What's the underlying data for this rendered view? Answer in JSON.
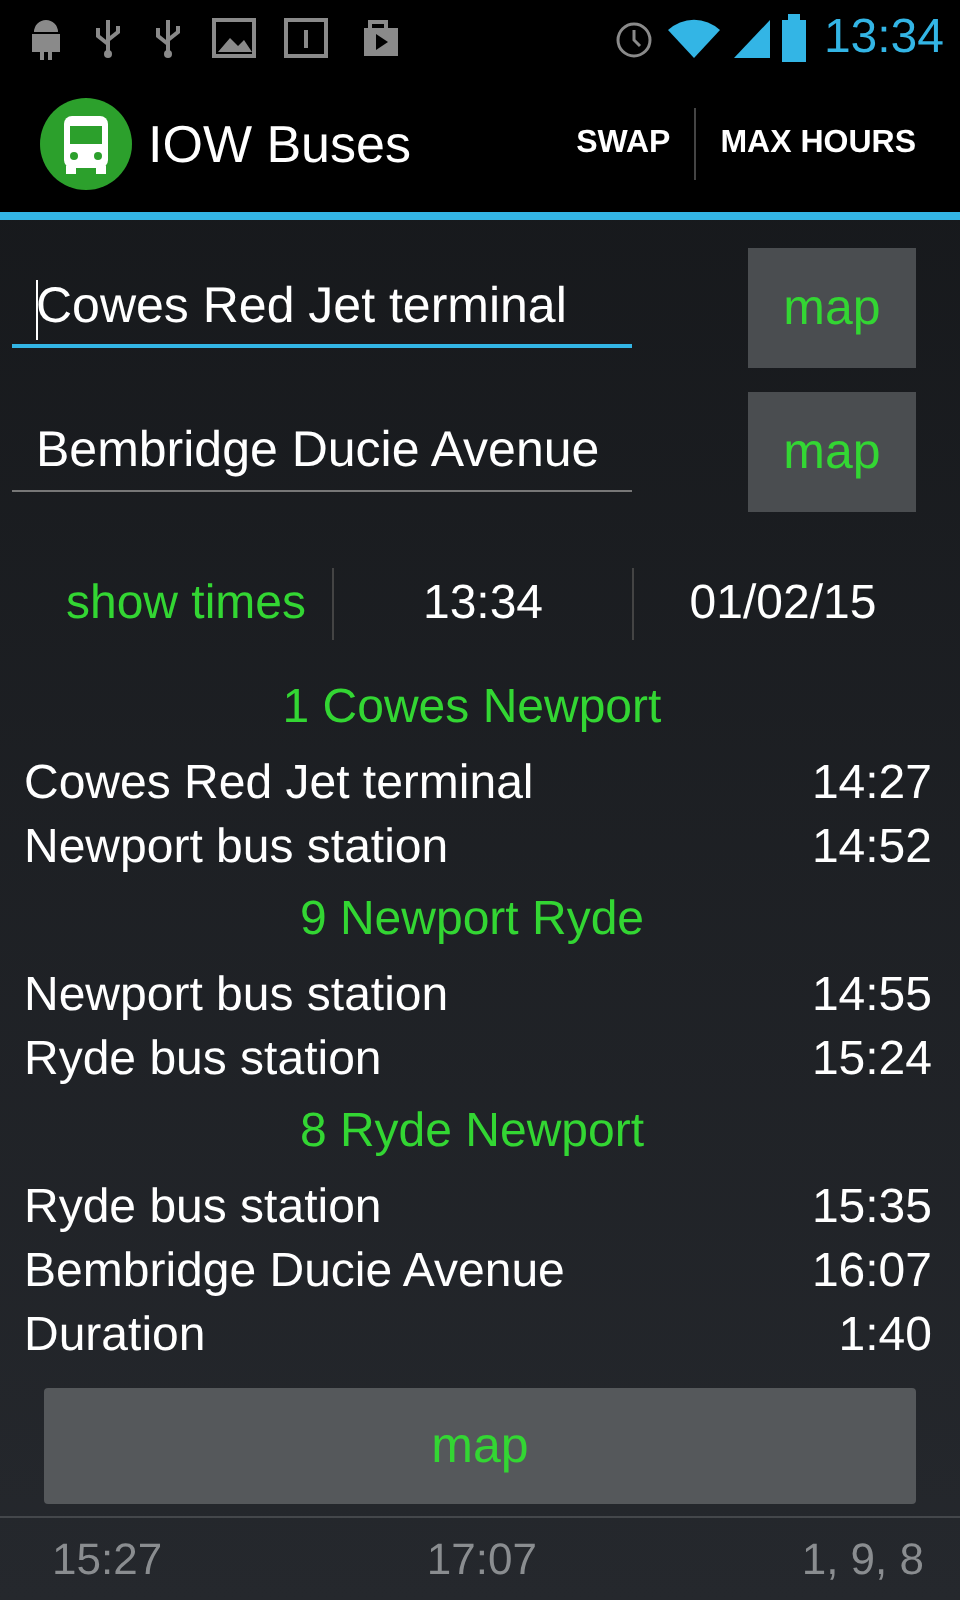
{
  "status_bar": {
    "time": "13:34"
  },
  "action_bar": {
    "title": "IOW Buses",
    "actions": [
      "SWAP",
      "MAX HOURS"
    ]
  },
  "fields": [
    {
      "value": "Cowes Red Jet terminal",
      "focused": true,
      "button": "map"
    },
    {
      "value": "Bembridge Ducie Avenue",
      "focused": false,
      "button": "map"
    }
  ],
  "time_row": {
    "show_times": "show times",
    "time": "13:34",
    "date": "01/02/15"
  },
  "legs": [
    {
      "route": "1 Cowes Newport",
      "stops": [
        {
          "name": "Cowes Red Jet terminal",
          "time": "14:27"
        },
        {
          "name": "Newport bus station",
          "time": "14:52"
        }
      ]
    },
    {
      "route": "9 Newport Ryde",
      "stops": [
        {
          "name": "Newport bus station",
          "time": "14:55"
        },
        {
          "name": "Ryde bus station",
          "time": "15:24"
        }
      ]
    },
    {
      "route": "8 Ryde Newport",
      "stops": [
        {
          "name": "Ryde bus station",
          "time": "15:35"
        },
        {
          "name": "Bembridge Ducie Avenue",
          "time": "16:07"
        }
      ]
    }
  ],
  "duration": {
    "label": "Duration",
    "time": "1:40"
  },
  "map_button": "map",
  "next_journey": [
    "15:27",
    "17:07",
    "1, 9, 8"
  ]
}
